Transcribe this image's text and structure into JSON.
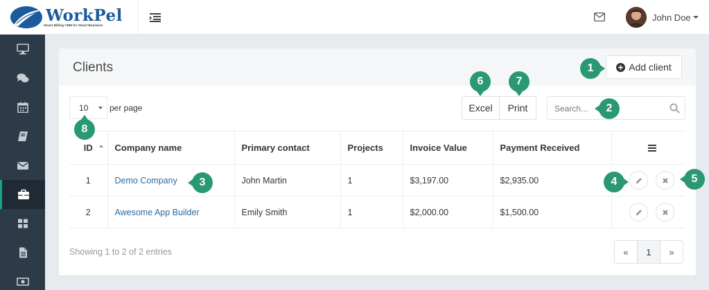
{
  "brand": {
    "name": "WorkPel",
    "tagline": "Smart Billing CRM for Smart Business"
  },
  "header": {
    "user_name": "John Doe"
  },
  "sidebar": {
    "items": [
      {
        "icon": "monitor-icon"
      },
      {
        "icon": "chat-icon"
      },
      {
        "icon": "calendar-icon"
      },
      {
        "icon": "book-icon"
      },
      {
        "icon": "envelope-icon"
      },
      {
        "icon": "briefcase-icon",
        "active": true
      },
      {
        "icon": "grid-icon"
      },
      {
        "icon": "file-icon"
      },
      {
        "icon": "money-icon"
      }
    ]
  },
  "panel": {
    "title": "Clients",
    "add_label": "Add client",
    "per_page_value": "10",
    "per_page_label": "per page",
    "excel_label": "Excel",
    "print_label": "Print",
    "search_placeholder": "Search..."
  },
  "table": {
    "columns": [
      "ID",
      "Company name",
      "Primary contact",
      "Projects",
      "Invoice Value",
      "Payment Received"
    ],
    "rows": [
      {
        "id": "1",
        "company": "Demo Company",
        "contact": "John Martin",
        "projects": "1",
        "invoice": "$3,197.00",
        "payment": "$2,935.00"
      },
      {
        "id": "2",
        "company": "Awesome App Builder",
        "contact": "Emily Smith",
        "projects": "1",
        "invoice": "$2,000.00",
        "payment": "$1,500.00"
      }
    ]
  },
  "footer": {
    "showing": "Showing 1 to 2 of 2 entries",
    "prev": "«",
    "page": "1",
    "next": "»"
  },
  "markers": [
    "1",
    "2",
    "3",
    "4",
    "5",
    "6",
    "7",
    "8"
  ],
  "colors": {
    "accent": "#2a9873",
    "sidebar": "#2d3a47",
    "link": "#2c6aa0",
    "brand": "#1b5a9c"
  }
}
